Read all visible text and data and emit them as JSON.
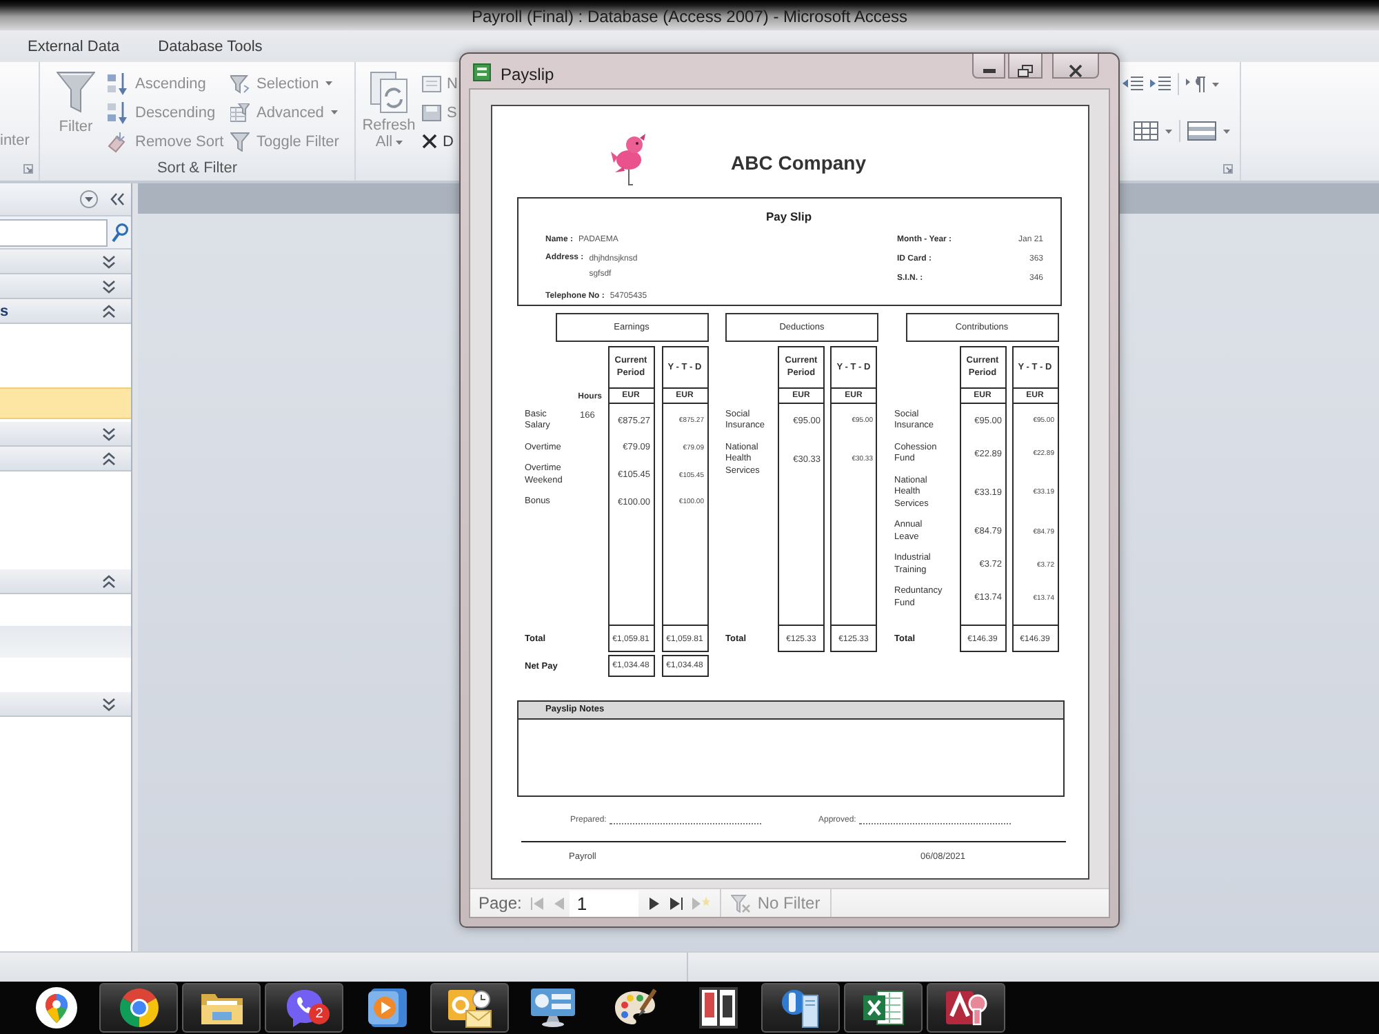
{
  "window": {
    "title": "Payroll (Final) : Database (Access 2007) - Microsoft Access"
  },
  "ribbon": {
    "tabs": [
      {
        "label": "External Data",
        "selected": false
      },
      {
        "label": "Database Tools",
        "selected": false
      }
    ],
    "clipboard_group": {
      "button_label": "inter"
    },
    "sort_filter_group": {
      "label": "Sort & Filter",
      "filter_button": {
        "label": "Filter",
        "disabled": true
      },
      "sort_buttons": [
        {
          "kind": "ascending",
          "label": "Ascending",
          "disabled": true
        },
        {
          "kind": "descending",
          "label": "Descending",
          "disabled": true
        },
        {
          "kind": "remove_sort",
          "label": "Remove Sort",
          "disabled": true
        }
      ],
      "filter_buttons": [
        {
          "kind": "selection",
          "label": "Selection",
          "dropdown": true,
          "disabled": true
        },
        {
          "kind": "advanced",
          "label": "Advanced",
          "dropdown": true,
          "disabled": true
        },
        {
          "kind": "toggle",
          "label": "Toggle Filter",
          "dropdown": false,
          "disabled": true
        }
      ]
    },
    "records_group": {
      "refresh_button": {
        "label": "Refresh All",
        "disabled": true
      },
      "buttons": [
        {
          "kind": "new",
          "label": "N",
          "disabled": true
        },
        {
          "kind": "save",
          "label": "S",
          "disabled": true
        },
        {
          "kind": "delete",
          "label": "D",
          "disabled": false
        }
      ]
    }
  },
  "navigation_pane": {
    "sections": [
      {
        "expanded": false
      },
      {
        "expanded": false
      },
      {
        "label": "s",
        "expanded": true,
        "items": [
          {
            "selected": true,
            "highlighted": false
          }
        ]
      },
      {
        "expanded": false
      },
      {
        "expanded": true
      },
      {
        "expanded": true,
        "items": [
          {
            "selected": false,
            "highlighted": true
          }
        ]
      },
      {
        "expanded": false
      }
    ]
  },
  "payslip_window": {
    "title": "Payslip",
    "report": {
      "company": "ABC Company",
      "heading": "Pay Slip",
      "employee_fields": [
        {
          "label": "Name :",
          "lines": [
            "PADAEMA"
          ]
        },
        {
          "label": "Address :",
          "lines": [
            "dhjhdnsjknsd",
            "sgfsdf"
          ]
        },
        {
          "label": "Telephone No :",
          "lines": [
            "54705435"
          ]
        }
      ],
      "period_fields": [
        {
          "label": "Month - Year :",
          "value": "Jan 21"
        },
        {
          "label": "ID Card :",
          "value": "363"
        },
        {
          "label": "S.I.N. :",
          "value": "346"
        }
      ],
      "sections": [
        {
          "title": "Earnings",
          "hours_heading": "Hours",
          "columns": [
            {
              "heading": "Current Period",
              "currency": "EUR"
            },
            {
              "heading": "Y - T - D",
              "currency": "EUR"
            }
          ],
          "rows": [
            {
              "label": "Basic Salary",
              "hours": "166",
              "amounts": [
                "€875.27",
                "€875.27"
              ]
            },
            {
              "label": "Overtime",
              "amounts": [
                "€79.09",
                "€79.09"
              ]
            },
            {
              "label": "Overtime Weekend",
              "amounts": [
                "€105.45",
                "€105.45"
              ]
            },
            {
              "label": "Bonus",
              "amounts": [
                "€100.00",
                "€100.00"
              ]
            }
          ],
          "total": {
            "label": "Total",
            "amounts": [
              "€1,059.81",
              "€1,059.81"
            ]
          },
          "net_pay": {
            "label": "Net Pay",
            "amounts": [
              "€1,034.48",
              "€1,034.48"
            ]
          }
        },
        {
          "title": "Deductions",
          "columns": [
            {
              "heading": "Current Period",
              "currency": "EUR"
            },
            {
              "heading": "Y - T - D",
              "currency": "EUR"
            }
          ],
          "rows": [
            {
              "label": "Social Insurance",
              "amounts": [
                "€95.00",
                "€95.00"
              ]
            },
            {
              "label": "National Health Services",
              "amounts": [
                "€30.33",
                "€30.33"
              ]
            }
          ],
          "total": {
            "label": "Total",
            "amounts": [
              "€125.33",
              "€125.33"
            ]
          }
        },
        {
          "title": "Contributions",
          "columns": [
            {
              "heading": "Current Period",
              "currency": "EUR"
            },
            {
              "heading": "Y - T - D",
              "currency": "EUR"
            }
          ],
          "rows": [
            {
              "label": "Social Insurance",
              "amounts": [
                "€95.00",
                "€95.00"
              ]
            },
            {
              "label": "Cohession Fund",
              "amounts": [
                "€22.89",
                "€22.89"
              ]
            },
            {
              "label": "National Health Services",
              "amounts": [
                "€33.19",
                "€33.19"
              ]
            },
            {
              "label": "Annual Leave",
              "amounts": [
                "€84.79",
                "€84.79"
              ]
            },
            {
              "label": "Industrial Training",
              "amounts": [
                "€3.72",
                "€3.72"
              ]
            },
            {
              "label": "Reduntancy Fund",
              "amounts": [
                "€13.74",
                "€13.74"
              ]
            }
          ],
          "total": {
            "label": "Total",
            "amounts": [
              "€146.39",
              "€146.39"
            ]
          }
        }
      ],
      "notes": {
        "title": "Payslip Notes"
      },
      "signatures": [
        {
          "label": "Prepared:"
        },
        {
          "label": "Approved:"
        }
      ],
      "footer": {
        "left": "Payroll",
        "right": "06/08/2021"
      }
    },
    "record_navigation": {
      "label": "Page:",
      "page": "1",
      "buttons": [
        {
          "kind": "first",
          "disabled": true
        },
        {
          "kind": "previous",
          "disabled": true
        },
        {
          "kind": "next",
          "disabled": false
        },
        {
          "kind": "last",
          "disabled": false
        },
        {
          "kind": "new",
          "disabled": true
        }
      ],
      "filter": {
        "label": "No Filter",
        "disabled": true
      }
    }
  },
  "taskbar": {
    "items": [
      {
        "kind": "maps",
        "running": false
      },
      {
        "kind": "browser",
        "running": true
      },
      {
        "kind": "files",
        "running": true
      },
      {
        "kind": "messenger",
        "running": true,
        "badge": "2"
      },
      {
        "kind": "media",
        "running": false
      },
      {
        "kind": "mail",
        "running": true
      },
      {
        "kind": "remote",
        "running": false
      },
      {
        "kind": "paint",
        "running": false
      },
      {
        "kind": "accounting",
        "running": false
      },
      {
        "kind": "server",
        "running": true
      },
      {
        "kind": "spreadsheet",
        "running": true
      },
      {
        "kind": "database",
        "running": true
      }
    ]
  }
}
